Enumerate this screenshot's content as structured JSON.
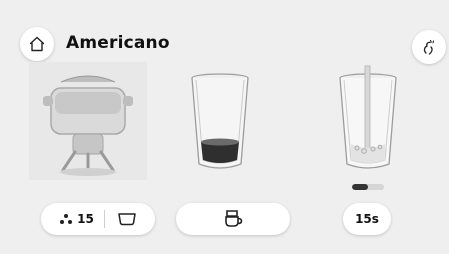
{
  "header": {
    "title": "Americano",
    "home_icon": "home-icon",
    "steam_icon": "steam-icon"
  },
  "steps": [
    {
      "name": "grinder",
      "icon": "grinder-icon"
    },
    {
      "name": "glass-with-espresso",
      "icon": "glass-espresso-icon"
    },
    {
      "name": "glass-with-hot-water",
      "icon": "glass-water-icon"
    }
  ],
  "progress": {
    "fraction": 0.5
  },
  "controls": {
    "strength": {
      "value": "15",
      "icon": "coffee-beans-icon"
    },
    "cup_icon": "cup-size-icon",
    "brew_icon": "coffee-cup-icon",
    "time_label": "15s"
  },
  "colors": {
    "background": "#efefef",
    "pill": "#ffffff",
    "text": "#111111"
  }
}
